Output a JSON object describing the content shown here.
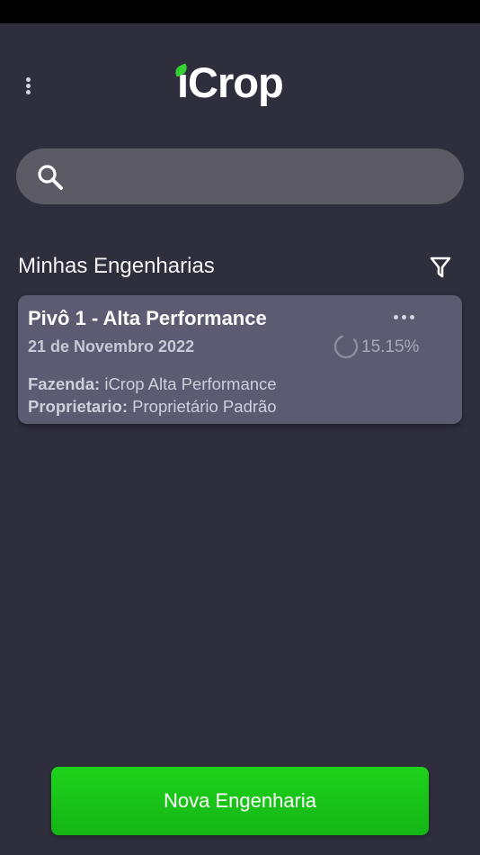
{
  "header": {
    "logo_text": "iCrop",
    "menu_icon": "more-vertical-icon"
  },
  "search": {
    "icon": "search-icon",
    "value": "",
    "placeholder": ""
  },
  "section": {
    "title": "Minhas Engenharias",
    "filter_icon": "filter-icon"
  },
  "cards": [
    {
      "title": "Pivô 1 - Alta Performance",
      "date": "21 de Novembro 2022",
      "progress_text": "15.15%",
      "progress_value": 0.1515,
      "farm_label": "Fazenda:",
      "farm_value": "iCrop Alta Performance",
      "owner_label": "Proprietario:",
      "owner_value": "Proprietário Padrão"
    }
  ],
  "footer": {
    "new_button_label": "Nova Engenharia"
  },
  "colors": {
    "background": "#2f2e3d",
    "card": "#5c5b72",
    "accent_green": "#1ec81b",
    "search_bg": "#5b5a65"
  }
}
